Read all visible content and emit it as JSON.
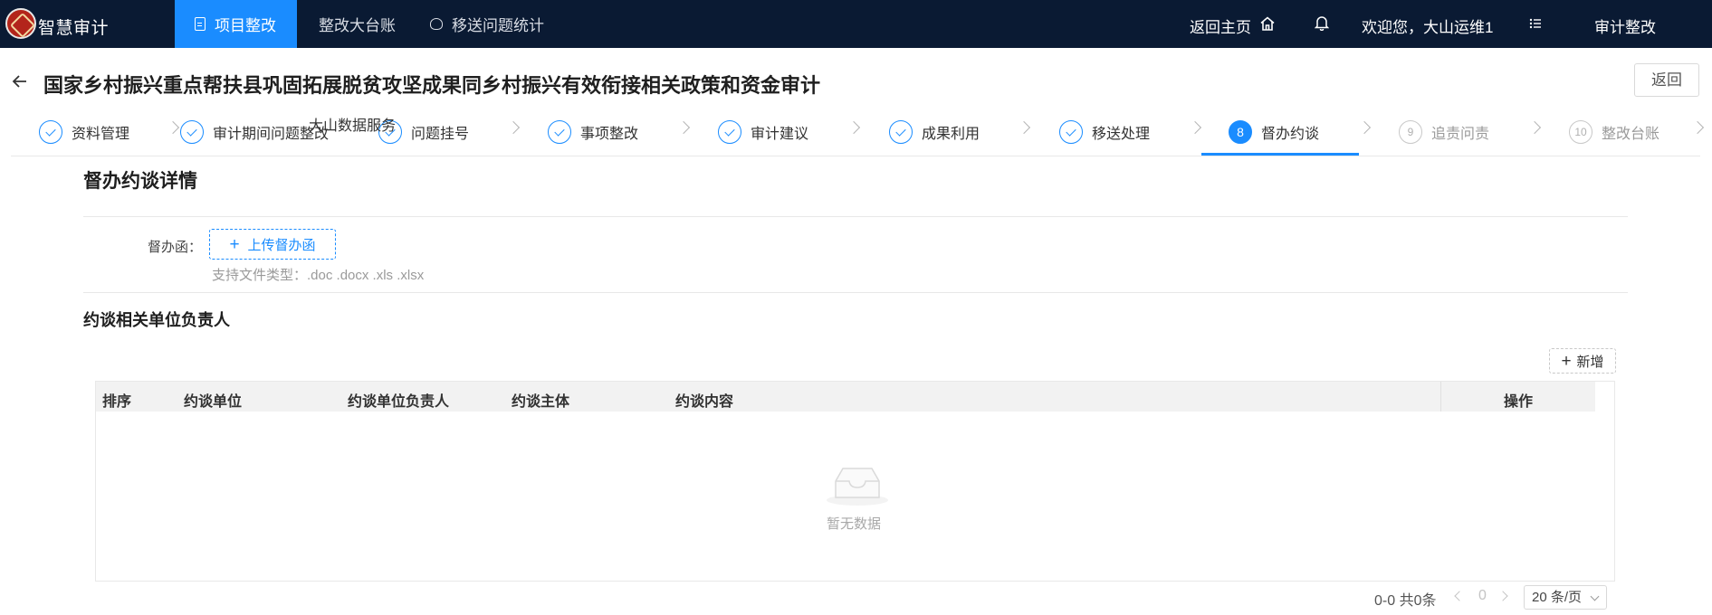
{
  "app": {
    "name": "智慧审计"
  },
  "topnav": {
    "items": [
      {
        "label": "项目整改",
        "icon": "document-icon",
        "active": true
      },
      {
        "label": "整改大台账",
        "active": false
      },
      {
        "label": "移送问题统计",
        "icon": "hexagon-icon",
        "active": false
      }
    ],
    "home_label": "返回主页",
    "welcome": "欢迎您，大山运维1",
    "system_name": "审计整改",
    "accent": "#1a8cff",
    "background": "#0a1a33"
  },
  "header": {
    "title": "国家乡村振兴重点帮扶县巩固拓展脱贫攻坚成果同乡村振兴有效衔接相关政策和资金审计",
    "back_button": "返回"
  },
  "steps": {
    "items": [
      {
        "label": "资料管理",
        "status": "done"
      },
      {
        "label": "审计期间问题整改",
        "status": "done"
      },
      {
        "label": "问题挂号",
        "status": "done"
      },
      {
        "label": "事项整改",
        "status": "done"
      },
      {
        "label": "审计建议",
        "status": "done"
      },
      {
        "label": "成果利用",
        "status": "done"
      },
      {
        "label": "移送处理",
        "status": "done"
      },
      {
        "label": "督办约谈",
        "status": "current",
        "number": "8"
      },
      {
        "label": "追责问责",
        "status": "todo",
        "number": "9"
      },
      {
        "label": "整改台账",
        "status": "todo",
        "number": "10"
      }
    ],
    "overlay_text": "大山数据服务"
  },
  "content": {
    "section_title": "督办约谈详情",
    "letter_label": "督办函：",
    "upload_button": "上传督办函",
    "upload_hint": "支持文件类型：.doc .docx .xls .xlsx",
    "sub_title": "约谈相关单位负责人",
    "add_button": "新增",
    "table": {
      "columns": [
        "排序",
        "约谈单位",
        "约谈单位负责人",
        "约谈主体",
        "约谈内容",
        "操作"
      ],
      "rows": [],
      "empty_text": "暂无数据"
    },
    "pagination": {
      "total": "0-0 共0条",
      "page": "0",
      "page_size": "20 条/页"
    }
  }
}
